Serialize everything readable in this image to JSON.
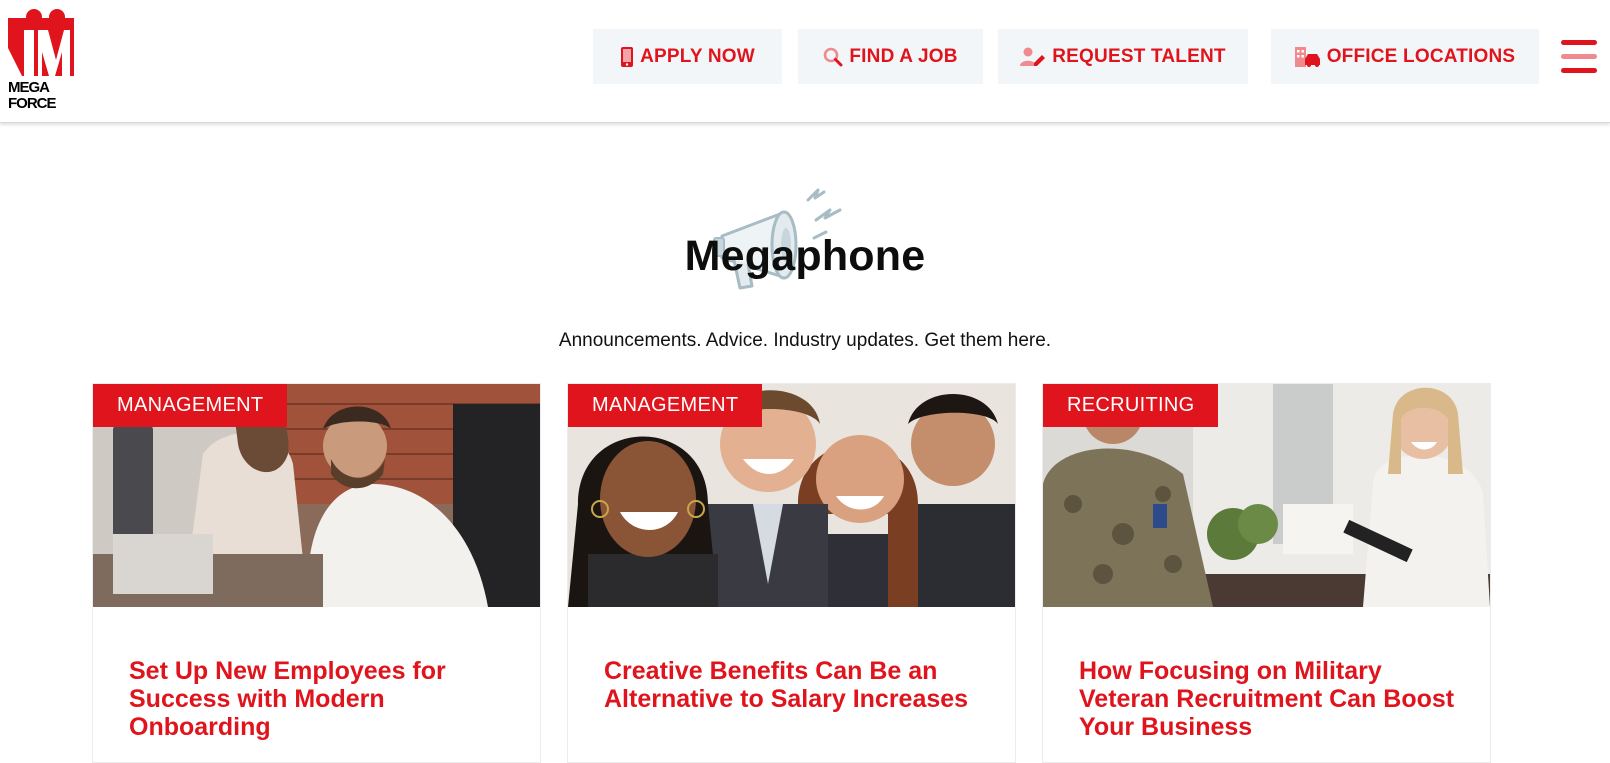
{
  "brand": {
    "logo_text_line1": "MEGA",
    "logo_text_line2": "FORCE",
    "accent": "#e0141c",
    "nav_bg": "#f2f6f8"
  },
  "nav": {
    "apply_now": {
      "label": "APPLY NOW",
      "icon": "phone-icon"
    },
    "find_job": {
      "label": "FIND A JOB",
      "icon": "search-icon"
    },
    "request_talent": {
      "label": "REQUEST TALENT",
      "icon": "user-edit-icon"
    },
    "office_locations": {
      "label": "OFFICE LOCATIONS",
      "icon": "building-car-icon"
    },
    "menu_icon": "hamburger-menu-icon"
  },
  "hero": {
    "title": "Megaphone",
    "subtitle": "Announcements. Advice. Industry updates. Get them here.",
    "icon": "megaphone-icon"
  },
  "posts": [
    {
      "category": "MANAGEMENT",
      "title": "Set Up New Employees for Success with Modern Onboarding"
    },
    {
      "category": "MANAGEMENT",
      "title": "Creative Benefits Can Be an Alternative to Salary Increases"
    },
    {
      "category": "RECRUITING",
      "title": "How Focusing on Military Veteran Recruitment Can Boost Your Business"
    }
  ]
}
